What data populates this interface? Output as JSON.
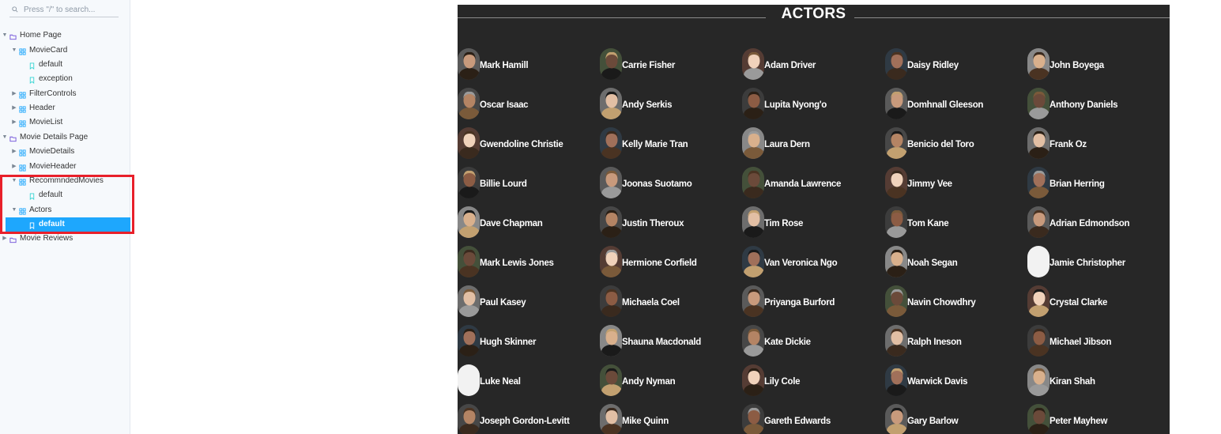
{
  "search": {
    "placeholder": "Press \"/\" to search..."
  },
  "sidebar": {
    "items": [
      {
        "label": "Home Page",
        "kind": "folder",
        "expanded": true,
        "selected": false
      },
      {
        "label": "MovieCard",
        "kind": "component",
        "expanded": true,
        "selected": false
      },
      {
        "label": "default",
        "kind": "story",
        "selected": false
      },
      {
        "label": "exception",
        "kind": "story",
        "selected": false
      },
      {
        "label": "FilterControls",
        "kind": "component",
        "expanded": false,
        "selected": false
      },
      {
        "label": "Header",
        "kind": "component",
        "expanded": false,
        "selected": false
      },
      {
        "label": "MovieList",
        "kind": "component",
        "expanded": false,
        "selected": false
      },
      {
        "label": "Movie Details Page",
        "kind": "folder",
        "expanded": true,
        "selected": false
      },
      {
        "label": "MovieDetails",
        "kind": "component",
        "expanded": false,
        "selected": false
      },
      {
        "label": "MovieHeader",
        "kind": "component",
        "expanded": false,
        "selected": false
      },
      {
        "label": "RecommndedMovies",
        "kind": "component",
        "expanded": true,
        "selected": false
      },
      {
        "label": "default",
        "kind": "story",
        "selected": false
      },
      {
        "label": "Actors",
        "kind": "component",
        "expanded": true,
        "selected": false
      },
      {
        "label": "default",
        "kind": "story",
        "selected": true
      },
      {
        "label": "Movie Reviews",
        "kind": "folder",
        "expanded": false,
        "selected": false
      }
    ]
  },
  "panel": {
    "title": "ACTORS"
  },
  "colors": {
    "accent": "#1ea7fd",
    "component_icon": "#1ea7fd",
    "folder_icon": "#6f4fd8",
    "story_icon": "#37d5d3",
    "highlight": "#e8202a",
    "panel_bg": "#272727"
  },
  "actors": [
    "Mark Hamill",
    "Carrie Fisher",
    "Adam Driver",
    "Daisy Ridley",
    "John Boyega",
    "Oscar Isaac",
    "Andy Serkis",
    "Lupita Nyong'o",
    "Domhnall Gleeson",
    "Anthony Daniels",
    "Gwendoline Christie",
    "Kelly Marie Tran",
    "Laura Dern",
    "Benicio del Toro",
    "Frank Oz",
    "Billie Lourd",
    "Joonas Suotamo",
    "Amanda Lawrence",
    "Jimmy Vee",
    "Brian Herring",
    "Dave Chapman",
    "Justin Theroux",
    "Tim Rose",
    "Tom Kane",
    "Adrian Edmondson",
    "Mark Lewis Jones",
    "Hermione Corfield",
    "Van Veronica Ngo",
    "Noah Segan",
    "Jamie Christopher",
    "Paul Kasey",
    "Michaela Coel",
    "Priyanga Burford",
    "Navin Chowdhry",
    "Crystal Clarke",
    "Hugh Skinner",
    "Shauna Macdonald",
    "Kate Dickie",
    "Ralph Ineson",
    "Michael Jibson",
    "Luke Neal",
    "Andy Nyman",
    "Lily Cole",
    "Warwick Davis",
    "Kiran Shah",
    "Joseph Gordon-Levitt",
    "Mike Quinn",
    "Gareth Edwards",
    "Gary Barlow",
    "Peter Mayhew"
  ]
}
